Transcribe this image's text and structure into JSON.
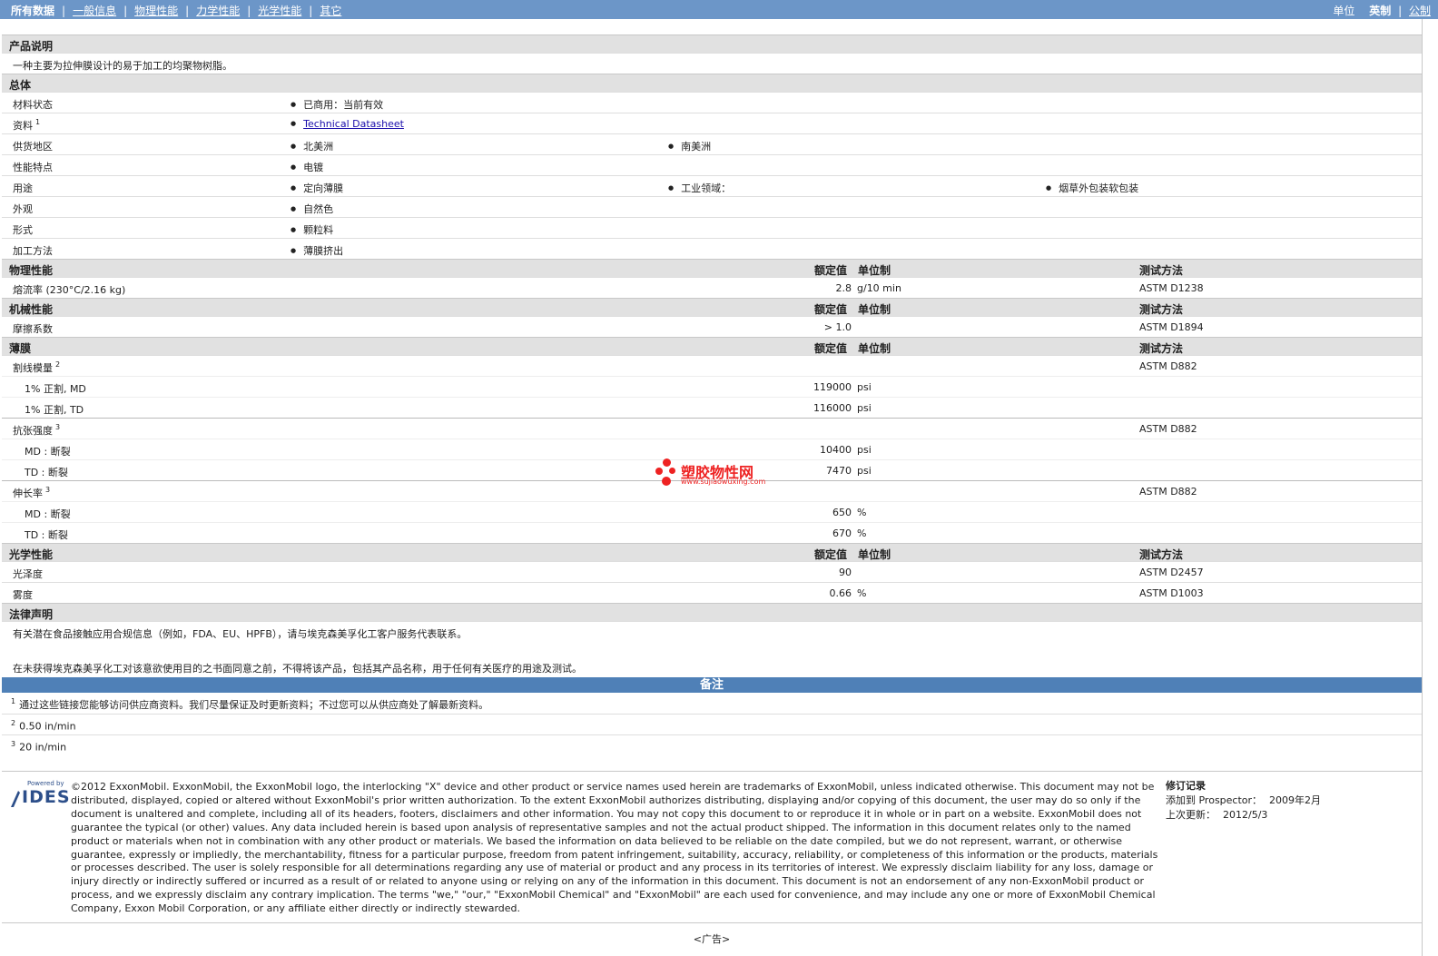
{
  "topbar": {
    "nav": [
      "所有数据",
      "一般信息",
      "物理性能",
      "力学性能",
      "光学性能",
      "其它"
    ],
    "unit_label": "单位",
    "unit_english": "英制",
    "unit_metric": "公制"
  },
  "product": {
    "title": "产品说明",
    "description": "一种主要为拉伸膜设计的易于加工的均聚物树脂。"
  },
  "general": {
    "title": "总体",
    "rows": [
      {
        "label": "材料状态",
        "values": [
          "已商用：当前有效"
        ]
      },
      {
        "label": "资料",
        "sup": "1",
        "values": [
          "Technical Datasheet"
        ],
        "link": true
      },
      {
        "label": "供货地区",
        "values": [
          "北美洲",
          "南美洲"
        ]
      },
      {
        "label": "性能特点",
        "values": [
          "电镀"
        ]
      },
      {
        "label": "用途",
        "values": [
          "定向薄膜",
          "工业领域：",
          "烟草外包装软包装"
        ]
      },
      {
        "label": "外观",
        "values": [
          "自然色"
        ]
      },
      {
        "label": "形式",
        "values": [
          "颗粒料"
        ]
      },
      {
        "label": "加工方法",
        "values": [
          "薄膜挤出"
        ]
      }
    ]
  },
  "headers": {
    "nominal": "额定值",
    "unit": "单位制",
    "method": "测试方法"
  },
  "physical": {
    "title": "物理性能",
    "rows": [
      {
        "label": "熔流率 (230°C/2.16 kg)",
        "value": "2.8",
        "unit": "g/10 min",
        "method": "ASTM D1238"
      }
    ]
  },
  "mechanical": {
    "title": "机械性能",
    "rows": [
      {
        "label": "摩擦系数",
        "value": "> 1.0",
        "unit": "",
        "method": "ASTM D1894"
      }
    ]
  },
  "film": {
    "title": "薄膜",
    "rows": [
      {
        "label": "割线模量",
        "sup": "2",
        "value": "",
        "unit": "",
        "method": "ASTM D882"
      },
      {
        "label": "1% 正割, MD",
        "indent": true,
        "value": "119000",
        "unit": "psi",
        "method": ""
      },
      {
        "label": "1% 正割, TD",
        "indent": true,
        "value": "116000",
        "unit": "psi",
        "method": ""
      },
      {
        "label": "抗张强度",
        "sup": "3",
        "value": "",
        "unit": "",
        "method": "ASTM D882"
      },
      {
        "label": "MD : 断裂",
        "indent": true,
        "value": "10400",
        "unit": "psi",
        "method": ""
      },
      {
        "label": "TD : 断裂",
        "indent": true,
        "value": "7470",
        "unit": "psi",
        "method": ""
      },
      {
        "label": "伸长率",
        "sup": "3",
        "value": "",
        "unit": "",
        "method": "ASTM D882"
      },
      {
        "label": "MD : 断裂",
        "indent": true,
        "value": "650",
        "unit": "%",
        "method": ""
      },
      {
        "label": "TD : 断裂",
        "indent": true,
        "value": "670",
        "unit": "%",
        "method": ""
      }
    ]
  },
  "optical": {
    "title": "光学性能",
    "rows": [
      {
        "label": "光泽度",
        "value": "90",
        "unit": "",
        "method": "ASTM D2457"
      },
      {
        "label": "雾度",
        "value": "0.66",
        "unit": "%",
        "method": "ASTM D1003"
      }
    ]
  },
  "legal": {
    "title": "法律声明",
    "p1": "有关潜在食品接触应用合规信息（例如，FDA、EU、HPFB），请与埃克森美孚化工客户服务代表联系。",
    "p2": "在未获得埃克森美孚化工对该意欲使用目的之书面同意之前，不得将该产品，包括其产品名称，用于任何有关医疗的用途及测试。"
  },
  "notes": {
    "title": "备注",
    "items": [
      {
        "sup": "1",
        "text": "通过这些链接您能够访问供应商资料。我们尽量保证及时更新资料；不过您可以从供应商处了解最新资料。"
      },
      {
        "sup": "2",
        "text": "0.50 in/min"
      },
      {
        "sup": "3",
        "text": "20 in/min"
      }
    ]
  },
  "watermark": {
    "title": "塑胶物性网",
    "url": "www.sujiaowuxing.com",
    "color": "#e22222"
  },
  "footer": {
    "logo_powered": "Powered by",
    "logo_name": "IDES",
    "copyright": "©2012 ExxonMobil. ExxonMobil, the ExxonMobil logo, the interlocking \"X\" device and other product or service names used herein are trademarks of ExxonMobil, unless indicated otherwise. This document may not be distributed, displayed, copied or altered without ExxonMobil's prior written authorization. To the extent ExxonMobil authorizes distributing, displaying and/or copying of this document, the user may do so only if the document is unaltered and complete, including all of its headers, footers, disclaimers and other information. You may not copy this document to or reproduce it in whole or in part on a website. ExxonMobil does not guarantee the typical (or other) values. Any data included herein is based upon analysis of representative samples and not the actual product shipped. The information in this document relates only to the named product or materials when not in combination with any other product or materials. We based the information on data believed to be reliable on the date compiled, but we do not represent, warrant, or otherwise guarantee, expressly or impliedly, the merchantability, fitness for a particular purpose, freedom from patent infringement, suitability, accuracy, reliability, or completeness of this information or the products, materials or processes described. The user is solely responsible for all determinations regarding any use of material or product and any process in its territories of interest. We expressly disclaim liability for any loss, damage or injury directly or indirectly suffered or incurred as a result of or related to anyone using or relying on any of the information in this document. This document is not an endorsement of any non-ExxonMobil product or process, and we expressly disclaim any contrary implication. The terms \"we,\" \"our,\" \"ExxonMobil Chemical\" and \"ExxonMobil\" are each used for convenience, and may include any one or more of ExxonMobil Chemical Company, Exxon Mobil Corporation, or any affiliate either directly or indirectly stewarded.",
    "revision_title": "修订记录",
    "added_label": "添加到 Prospector：",
    "added_value": "2009年2月",
    "updated_label": "上次更新：",
    "updated_value": "2012/5/3",
    "ad": "<广告>"
  },
  "colors": {
    "topbar": "#6c96c8",
    "section": "#e1e1e1",
    "notes_bar": "#4f80b7",
    "link": "#1a0dab"
  }
}
